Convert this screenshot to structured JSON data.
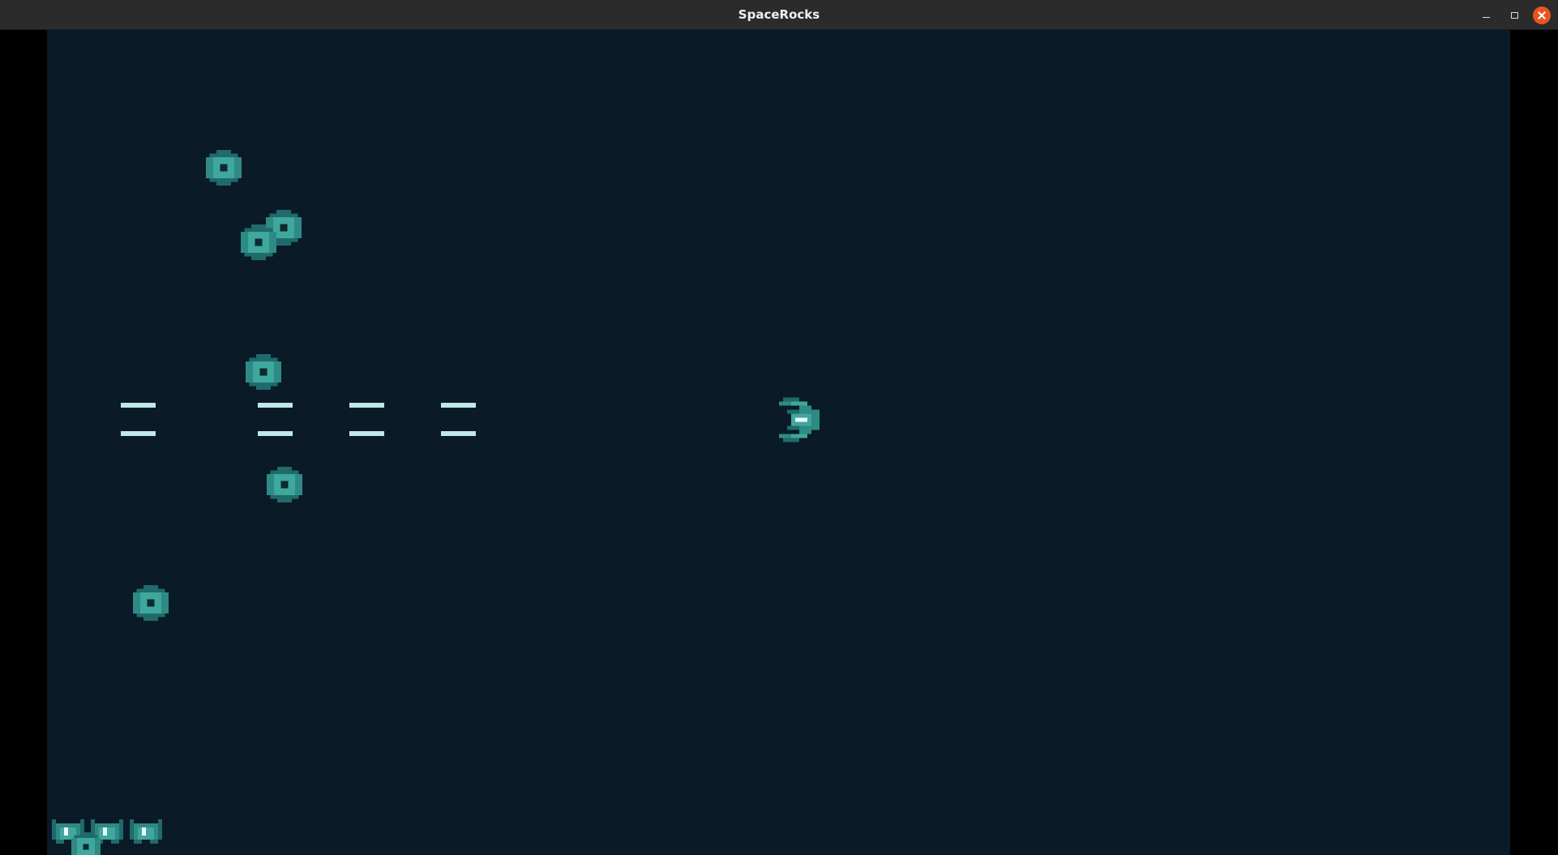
{
  "window": {
    "title": "SpaceRocks",
    "buttons": [
      "minimize",
      "maximize",
      "close"
    ]
  },
  "game": {
    "rocks_visible": 6,
    "ships_visible": 1,
    "lives_remaining": 3,
    "sprites": {
      "rock": "asteroid-icon",
      "ship": "spaceship-icon",
      "life": "life-ship-icon"
    },
    "colors": {
      "background": "#0b1a27",
      "sprite_dark": "#1f6b6b",
      "sprite_mid": "#2e8a85",
      "sprite_light": "#3fa79d",
      "bullet": "#bfe8e8",
      "letterbox": "#000000"
    }
  }
}
